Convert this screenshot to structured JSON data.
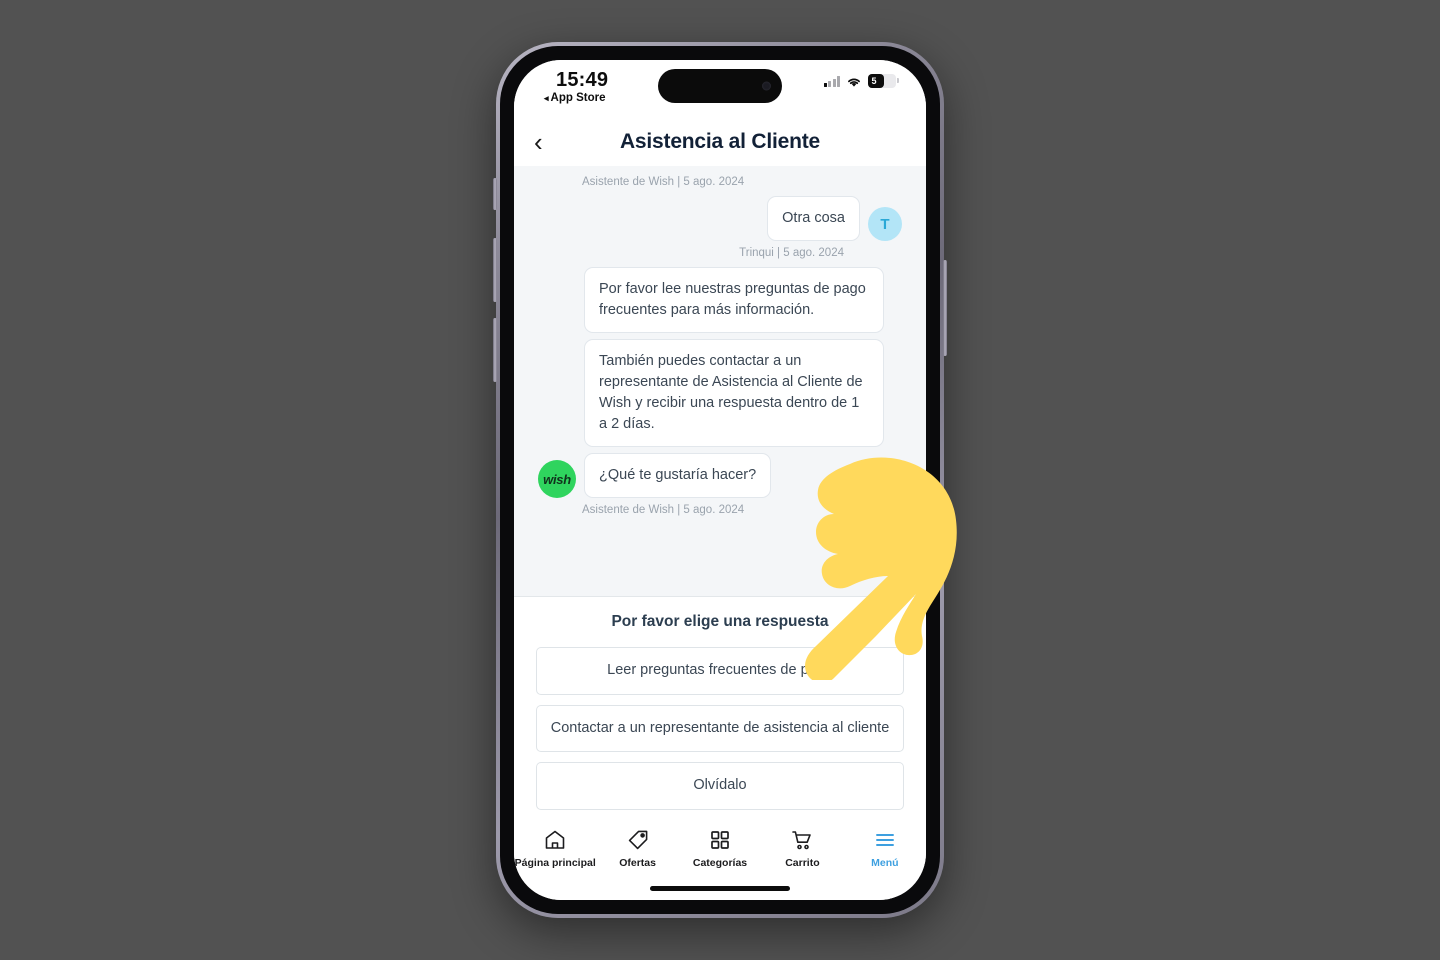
{
  "canvas": {
    "background_color": "#525252"
  },
  "device": {
    "frame_color": "#8e8b9a",
    "buttons": [
      "mute-switch",
      "volume-up",
      "volume-down",
      "power"
    ]
  },
  "status_bar": {
    "time": "15:49",
    "back_app_arrow": "◂",
    "back_app_label": "App Store",
    "signal_icon": "cellular-signal-icon",
    "wifi_icon": "wifi-icon",
    "battery_percent": "5",
    "battery_icon": "battery-icon"
  },
  "header": {
    "back_icon": "‹",
    "title": "Asistencia al Cliente"
  },
  "chat": {
    "background_color": "#f4f6f8",
    "messages": [
      {
        "meta": "Asistente de Wish | 5 ago. 2024",
        "meta_align": "left",
        "position": "top"
      },
      {
        "side": "out",
        "text": "Otra cosa",
        "avatar_initial": "T",
        "avatar_color": "#b3e5f7",
        "meta": "Trinqui | 5 ago. 2024"
      },
      {
        "side": "in",
        "text": "Por favor lee nuestras preguntas de pago frecuentes para más información."
      },
      {
        "side": "in",
        "text": "También puedes contactar a un representante de Asistencia al Cliente de Wish y recibir una respuesta dentro de 1 a 2 días."
      },
      {
        "side": "in",
        "text": "¿Qué te gustaría hacer?",
        "avatar_label": "wish",
        "avatar_color": "#2fd45e",
        "meta": "Asistente de Wish | 5 ago. 2024"
      }
    ]
  },
  "picker": {
    "title": "Por favor elige una respuesta",
    "options": [
      {
        "label": "Leer preguntas frecuentes de pago"
      },
      {
        "label": "Contactar a un representante de asistencia al cliente"
      },
      {
        "label": "Olvídalo"
      }
    ]
  },
  "tabbar": {
    "items": [
      {
        "label": "Página principal",
        "icon": "home-icon",
        "active": false
      },
      {
        "label": "Ofertas",
        "icon": "tag-icon",
        "active": false
      },
      {
        "label": "Categorías",
        "icon": "grid-icon",
        "active": false
      },
      {
        "label": "Carrito",
        "icon": "cart-icon",
        "active": false
      },
      {
        "label": "Menú",
        "icon": "hamburger-icon",
        "active": true
      }
    ],
    "active_color": "#3ea0e0"
  },
  "cursor": {
    "icon": "pointing-hand-cursor",
    "color": "#ffd95c"
  }
}
